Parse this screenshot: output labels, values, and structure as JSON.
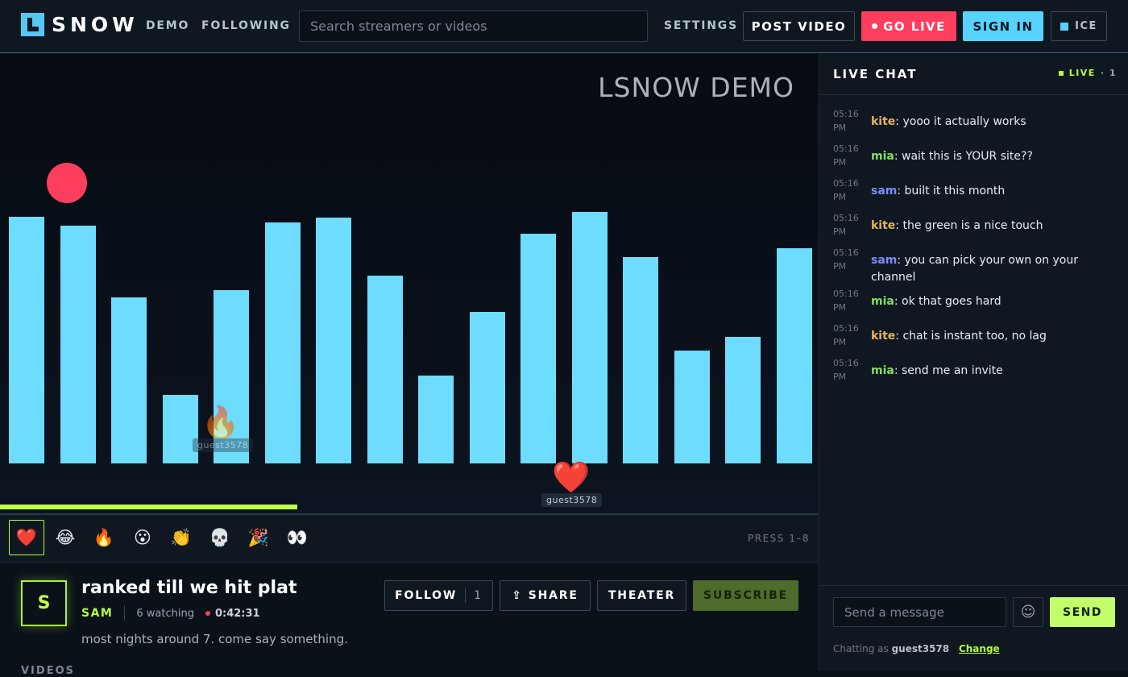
{
  "app": {
    "logo_text": "SNOW",
    "logo_icon": "l-logo-icon",
    "accent": "#b6ff3f",
    "brand": "#55c8f2"
  },
  "nav": {
    "demo": "DEMO",
    "following": "FOLLOWING",
    "settings": "SETTINGS"
  },
  "search": {
    "placeholder": "Search streamers or videos",
    "value": ""
  },
  "header": {
    "post_video": "POST VIDEO",
    "go_live": "GO LIVE",
    "sign_in": "SIGN IN",
    "theme": "ICE"
  },
  "player": {
    "watermark": "LSNOW DEMO",
    "progress_percent": 36.3,
    "bar_levels": [
      0.535,
      0.515,
      0.36,
      0.148,
      0.375,
      0.522,
      0.534,
      0.408,
      0.19,
      0.328,
      0.498,
      0.545,
      0.447,
      0.245,
      0.274,
      0.467
    ],
    "floating_reactions": [
      {
        "emoji": "🔥",
        "user": "guest3578"
      },
      {
        "emoji": "❤️",
        "user": "guest3578"
      }
    ]
  },
  "reactions": {
    "items": [
      {
        "emoji": "❤️",
        "name": "heart"
      },
      {
        "emoji": "😂",
        "name": "laugh"
      },
      {
        "emoji": "🔥",
        "name": "fire"
      },
      {
        "emoji": "😮",
        "name": "wow"
      },
      {
        "emoji": "👏",
        "name": "clap"
      },
      {
        "emoji": "💀",
        "name": "skull"
      },
      {
        "emoji": "🎉",
        "name": "party"
      },
      {
        "emoji": "👀",
        "name": "eyes"
      }
    ],
    "hint": "PRESS 1–8"
  },
  "stream": {
    "avatar_letter": "S",
    "title": "ranked till we hit plat",
    "host": "SAM",
    "watching": "6 watching",
    "elapsed": "0:42:31",
    "description": "most nights around 7. come say something.",
    "videos_heading": "VIDEOS"
  },
  "actions": {
    "follow": "FOLLOW",
    "follow_count": "1",
    "share": "SHARE",
    "theater": "THEATER",
    "subscribe": "SUBSCRIBE"
  },
  "chat": {
    "title": "LIVE CHAT",
    "live_label": "LIVE",
    "live_count": "· 1",
    "messages": [
      {
        "time": "05:16 PM",
        "user": "kite",
        "color": "#e8b45a",
        "text": "yooo it actually works"
      },
      {
        "time": "05:16 PM",
        "user": "mia",
        "color": "#7ee05a",
        "text": "wait this is YOUR site??"
      },
      {
        "time": "05:16 PM",
        "user": "sam",
        "color": "#7f8cff",
        "text": "built it this month"
      },
      {
        "time": "05:16 PM",
        "user": "kite",
        "color": "#e8b45a",
        "text": "the green is a nice touch"
      },
      {
        "time": "05:16 PM",
        "user": "sam",
        "color": "#7f8cff",
        "text": "you can pick your own on your channel"
      },
      {
        "time": "05:16 PM",
        "user": "mia",
        "color": "#7ee05a",
        "text": "ok that goes hard"
      },
      {
        "time": "05:16 PM",
        "user": "kite",
        "color": "#e8b45a",
        "text": "chat is instant too, no lag"
      },
      {
        "time": "05:16 PM",
        "user": "mia",
        "color": "#7ee05a",
        "text": "send me an invite"
      }
    ],
    "input_placeholder": "Send a message",
    "send": "SEND",
    "chatting_as_label": "Chatting as",
    "chatting_as_user": "guest3578",
    "change": "Change"
  }
}
